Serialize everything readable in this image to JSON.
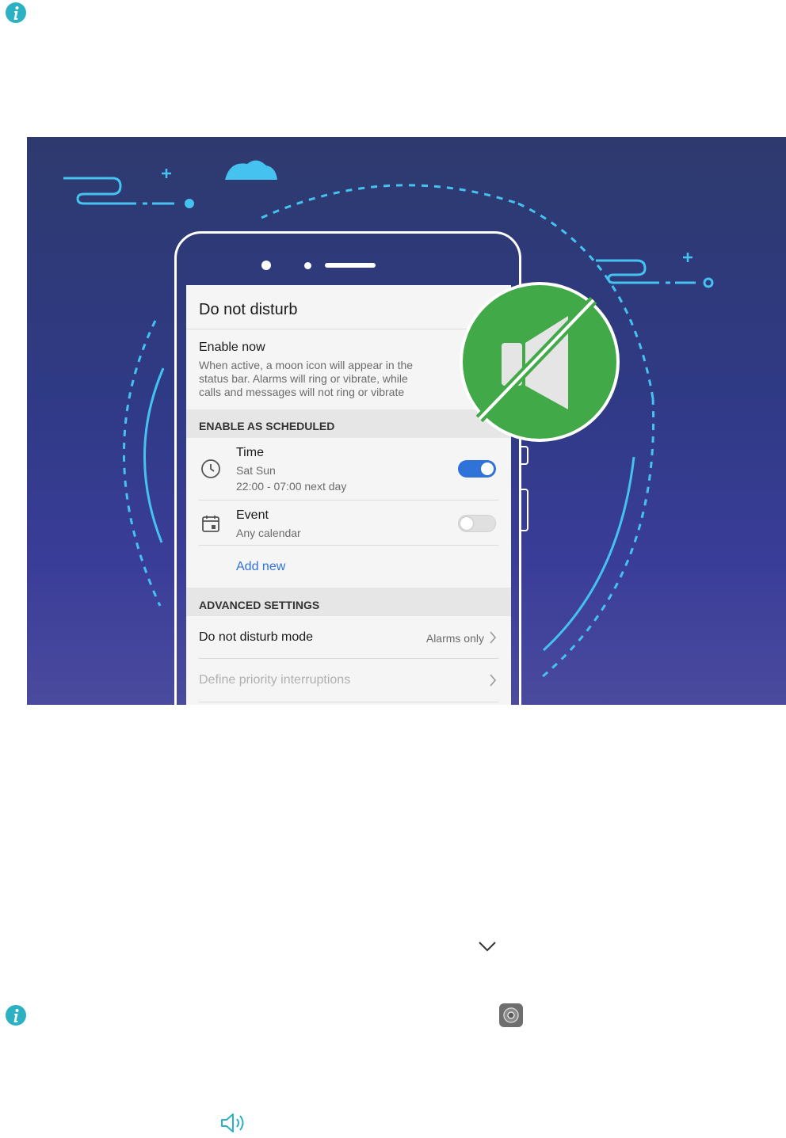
{
  "illustration": {
    "screen": {
      "title": "Do not disturb",
      "enable_now": {
        "label": "Enable now",
        "description_lines": [
          "When active, a moon icon will appear in the",
          "status bar. Alarms will ring or vibrate, while",
          "calls and messages will not ring or vibrate"
        ]
      },
      "section_scheduled": "ENABLE AS SCHEDULED",
      "time_item": {
        "label": "Time",
        "days": "Sat Sun",
        "range": "22:00 - 07:00 next day",
        "icon": "clock-icon",
        "enabled": true
      },
      "event_item": {
        "label": "Event",
        "sub": "Any calendar",
        "icon": "calendar-icon",
        "enabled": false
      },
      "add_new": "Add new",
      "section_advanced": "ADVANCED SETTINGS",
      "dnd_mode": {
        "label": "Do not disturb mode",
        "value": "Alarms only"
      },
      "priority": {
        "label": "Define priority interruptions"
      }
    },
    "badge_icon": "muted-speaker-icon"
  },
  "icons": {
    "info_top": "info-icon",
    "chevron": "chevron-down-icon",
    "info_bottom": "info-icon",
    "settings_app": "settings-app-icon",
    "volume": "volume-icon"
  },
  "colors": {
    "info": "#2bb1c1",
    "background_top": "#2e3a6e",
    "background_bottom": "#4a4a9e",
    "accent_cyan": "#45c2ef",
    "badge_green": "#41a948",
    "toggle_on": "#2f73d9",
    "link_blue": "#2f73d9"
  }
}
